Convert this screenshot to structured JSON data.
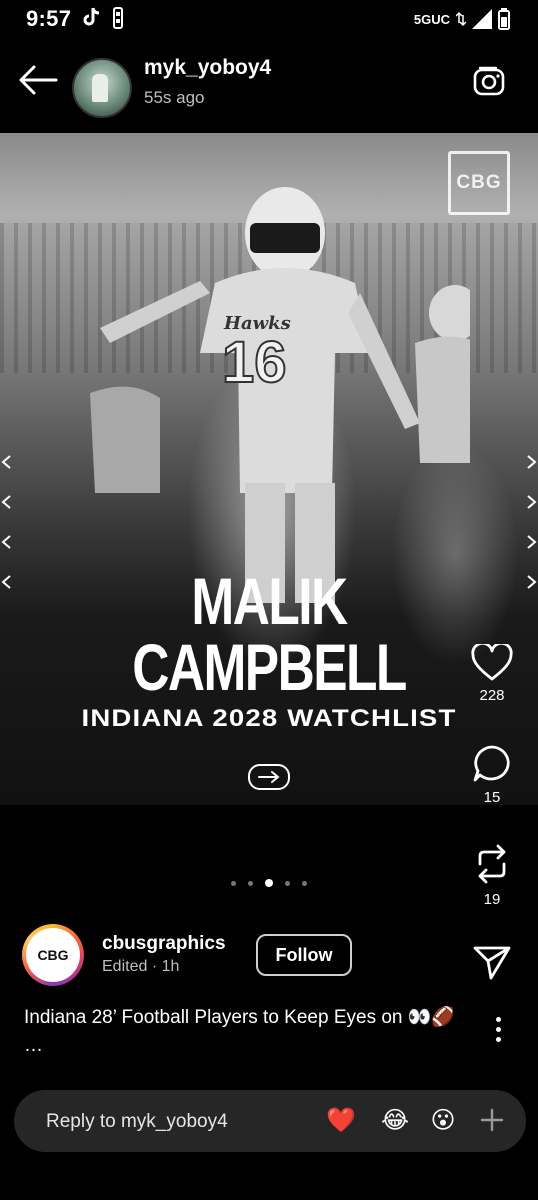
{
  "status_bar": {
    "time": "9:57",
    "network": "5GUC",
    "icons": [
      "tiktok-icon",
      "usb-debug-icon",
      "signal-icon",
      "battery-icon"
    ]
  },
  "header": {
    "username": "myk_yoboy4",
    "time_ago": "55s ago",
    "icons": [
      "back-arrow-icon",
      "camera-icon"
    ]
  },
  "post": {
    "logo_text": "CBG",
    "headline": "MALIK CAMPBELL",
    "subheadline": "INDIANA 2028 WATCHLIST",
    "jersey_number": "16",
    "team": "Hawks"
  },
  "actions": {
    "likes": "228",
    "comments": "15",
    "reposts": "19",
    "icons": [
      "heart-icon",
      "comment-icon",
      "repost-icon",
      "send-icon"
    ]
  },
  "carousel": {
    "total": 5,
    "active_index": 2
  },
  "author": {
    "avatar_text": "CBG",
    "name": "cbusgraphics",
    "meta": "Edited · 1h",
    "follow_label": "Follow"
  },
  "caption": "Indiana 28’ Football Players to Keep Eyes on 👀🏈 …",
  "reply": {
    "placeholder": "Reply to myk_yoboy4",
    "emojis": [
      "❤️",
      "😂",
      "😮"
    ],
    "icons": [
      "plus-icon"
    ]
  },
  "colors": {
    "background": "#000000",
    "reply_bar": "#262626",
    "heart_emoji": "#e0245e"
  }
}
